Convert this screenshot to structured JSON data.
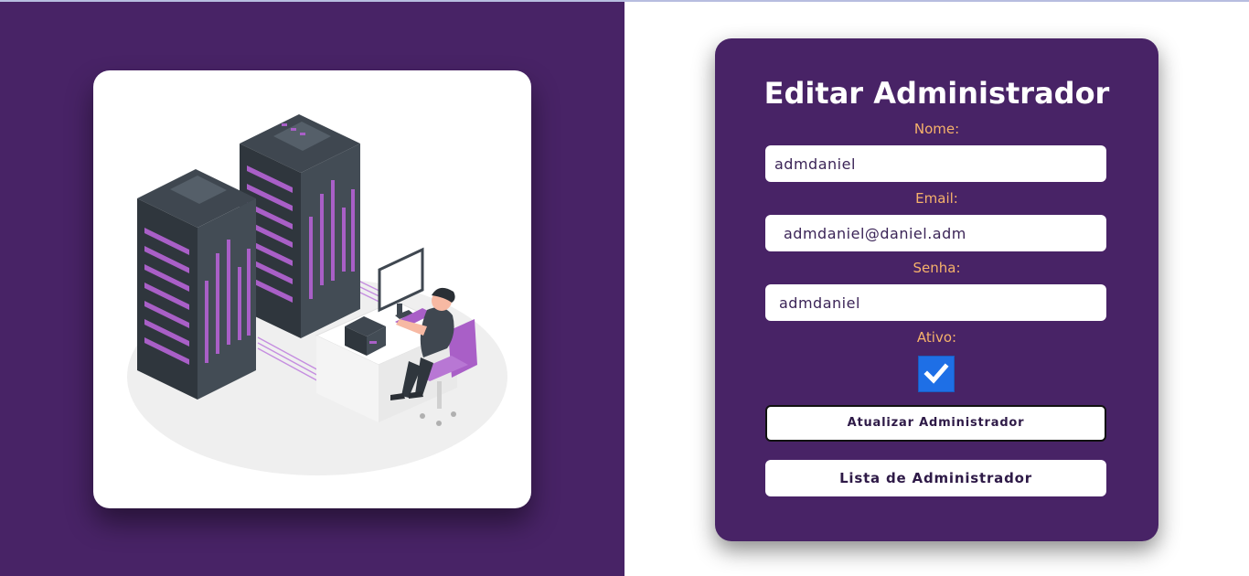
{
  "form": {
    "title": "Editar Administrador",
    "fields": [
      {
        "label": "Nome:",
        "value": "admdaniel"
      },
      {
        "label": "Email:",
        "value": "admdaniel@daniel.adm"
      },
      {
        "label": "Senha:",
        "value": "admdaniel"
      }
    ],
    "active": {
      "label": "Ativo:",
      "checked": true
    },
    "update_button": "Atualizar Administrador",
    "list_button": "Lista de Administrador"
  },
  "colors": {
    "brand_purple": "#482366",
    "label_orange": "#f6b26b",
    "checkbox_blue": "#1e6fe6",
    "server_accent": "#a95fc7"
  },
  "illustration": {
    "icon": "server-room-illustration"
  }
}
